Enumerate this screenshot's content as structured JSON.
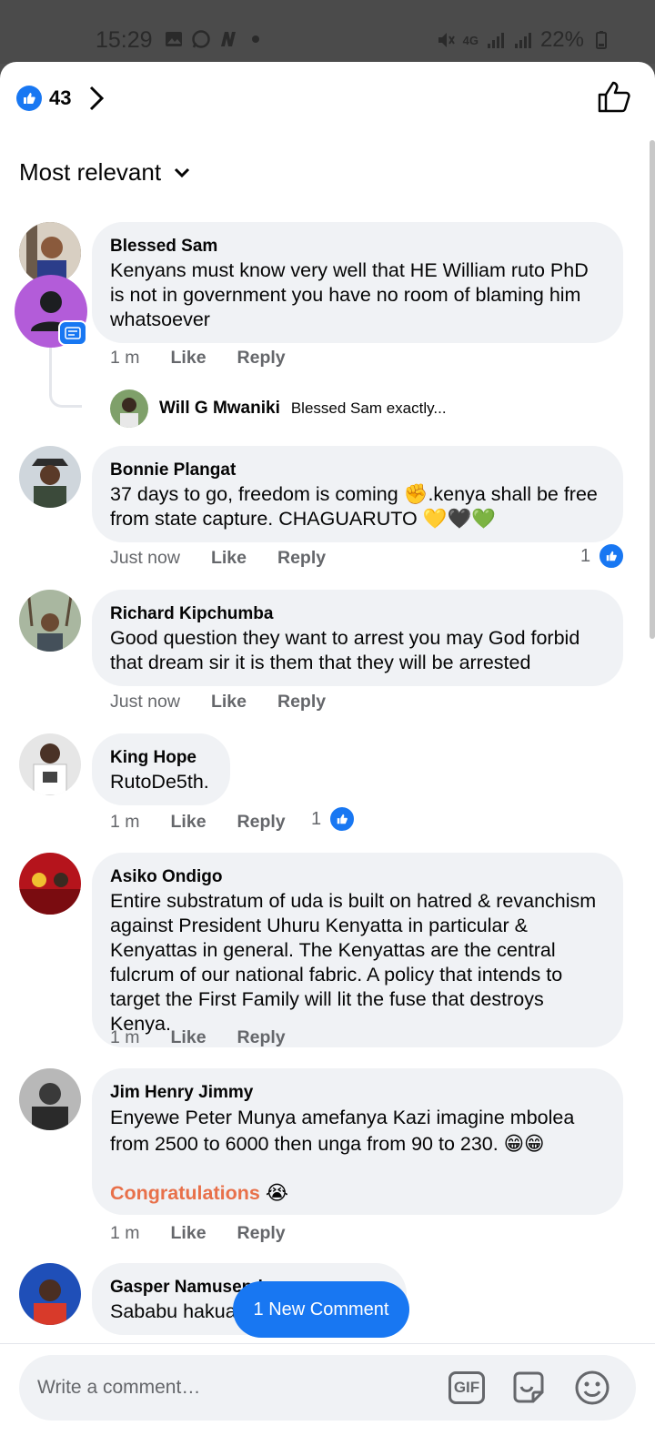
{
  "status_bar": {
    "time": "15:29",
    "network": "4G",
    "battery": "22%",
    "left_icons": [
      "image-icon",
      "whatsapp-icon",
      "n-app-icon",
      "dot-icon"
    ],
    "right_icons": [
      "mute-icon",
      "data-icon",
      "signal-icon",
      "signal-icon",
      "battery-icon"
    ]
  },
  "header": {
    "reaction_count": "43"
  },
  "sort": {
    "label": "Most relevant"
  },
  "comments": [
    {
      "author": "Blessed Sam",
      "text": "Kenyans must know very well that HE William ruto PhD is not in government you have no room of blaming him whatsoever",
      "time": "1 m",
      "like": "Like",
      "reply": "Reply",
      "reply_preview": {
        "author": "Will G Mwaniki",
        "text": "Blessed Sam exactly..."
      }
    },
    {
      "author": "Bonnie Plangat",
      "text": "37 days to go, freedom is coming ✊.kenya shall be free from state capture. CHAGUARUTO 💛🖤💚",
      "time": "Just now",
      "like": "Like",
      "reply": "Reply",
      "reactions": "1"
    },
    {
      "author": "Richard Kipchumba",
      "text": "Good question they want to arrest you may God forbid that dream sir it is them that they will be arrested",
      "time": "Just now",
      "like": "Like",
      "reply": "Reply"
    },
    {
      "author": "King Hope",
      "text": "RutoDe5th.",
      "time": "1 m",
      "like": "Like",
      "reply": "Reply",
      "reactions": "1"
    },
    {
      "author": "Asiko Ondigo",
      "text": "Entire substratum of uda is built on hatred & revanchism against President Uhuru Kenyatta in particular & Kenyattas in general. The Kenyattas are the central fulcrum of our national fabric. A policy that intends to target the First Family will lit the fuse that destroys Kenya.",
      "time": "1 m",
      "like": "Like",
      "reply": "Reply"
    },
    {
      "author": "Jim Henry Jimmy",
      "text": "Enyewe Peter Munya amefanya Kazi imagine mbolea from 2500 to 6000 then unga from 90 to 230. 😁😁",
      "highlight": "Congratulations",
      "highlight_emoji": "😭",
      "time": "1 m",
      "like": "Like",
      "reply": "Reply"
    },
    {
      "author": "Gasper Namusend",
      "text": "Sababu hakua"
    }
  ],
  "new_comment_button": "1 New Comment",
  "composer": {
    "placeholder": "Write a comment…",
    "gif_label": "GIF"
  },
  "colors": {
    "accent": "#1877f2",
    "bubble": "#f0f2f5",
    "secondary_text": "#65676b",
    "highlight": "#e8704a"
  }
}
